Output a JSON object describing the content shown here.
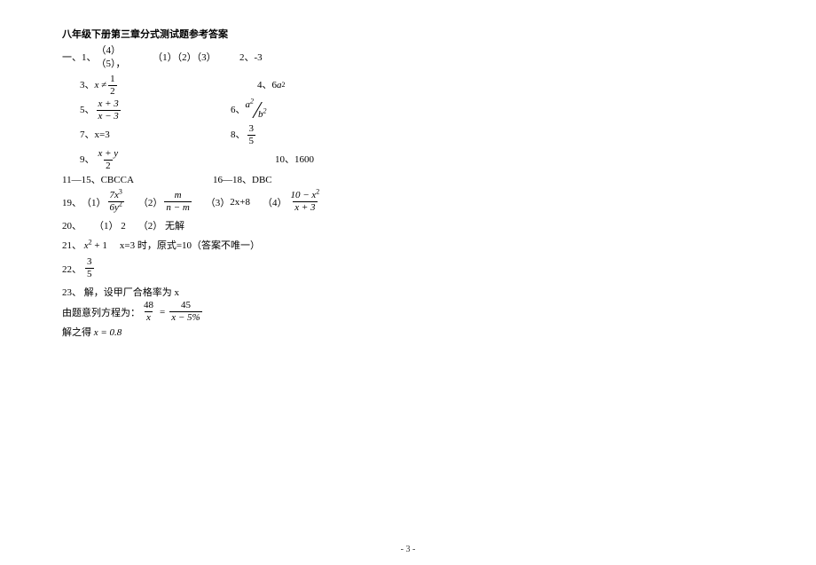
{
  "title": "八年级下册第三章分式测试题参考答案",
  "section1": {
    "label": "一、",
    "q1": {
      "label": "1、",
      "ansA": "（4）（5），",
      "ansB": "（1）（2）（3）"
    },
    "q2": {
      "label": "2、",
      "ans": "-3"
    },
    "q3": {
      "label": "3、",
      "prefix": "x ≠",
      "num": "1",
      "den": "2"
    },
    "q4": {
      "label": "4、",
      "coef": "6",
      "var": "a",
      "exp": "2"
    },
    "q5": {
      "label": "5、",
      "num": "x + 3",
      "den": "x − 3"
    },
    "q6": {
      "label": "6、",
      "dn": "a",
      "dnExp": "2",
      "dd": "b",
      "ddExp": "2"
    },
    "q7": {
      "label": "7、",
      "ans": "x=3"
    },
    "q8": {
      "label": "8、",
      "num": "3",
      "den": "5"
    },
    "q9": {
      "label": "9、",
      "num": "x + y",
      "den": "2"
    },
    "q10": {
      "label": "10、",
      "ans": "1600"
    },
    "q11_15": {
      "label": "11—15、",
      "ans": "CBCCA"
    },
    "q16_18": {
      "label": "16—18、",
      "ans": "DBC"
    }
  },
  "q19": {
    "label": "19、",
    "p1": {
      "label": "（1）",
      "num": "7x",
      "numExp": "3",
      "den": "6y",
      "denExp": "2"
    },
    "p2": {
      "label": "（2）",
      "num": "m",
      "den": "n − m"
    },
    "p3": {
      "label": "（3）",
      "ans": "2x+8"
    },
    "p4": {
      "label": "（4）",
      "num": "10 − x",
      "numExp": "2",
      "den": "x + 3"
    }
  },
  "q20": {
    "label": "20、",
    "p1": "（1） 2",
    "p2": "（2） 无解"
  },
  "q21": {
    "label": "21、",
    "expr": "x",
    "exprExp": "2",
    "exprTail": " + 1",
    "cond": "x=3 时，原式=10（答案不唯一）"
  },
  "q22": {
    "label": "22、",
    "num": "3",
    "den": "5"
  },
  "q23": {
    "label": "23、",
    "step1": "解，设甲厂合格率为 x",
    "step2Prefix": "由题意列方程为：",
    "lhsNum": "48",
    "lhsDen": "x",
    "eq": "=",
    "rhsNum": "45",
    "rhsDen": "x − 5%",
    "step3Prefix": "解之得  ",
    "step3Ans": "x = 0.8"
  },
  "pageNum": "- 3 -"
}
